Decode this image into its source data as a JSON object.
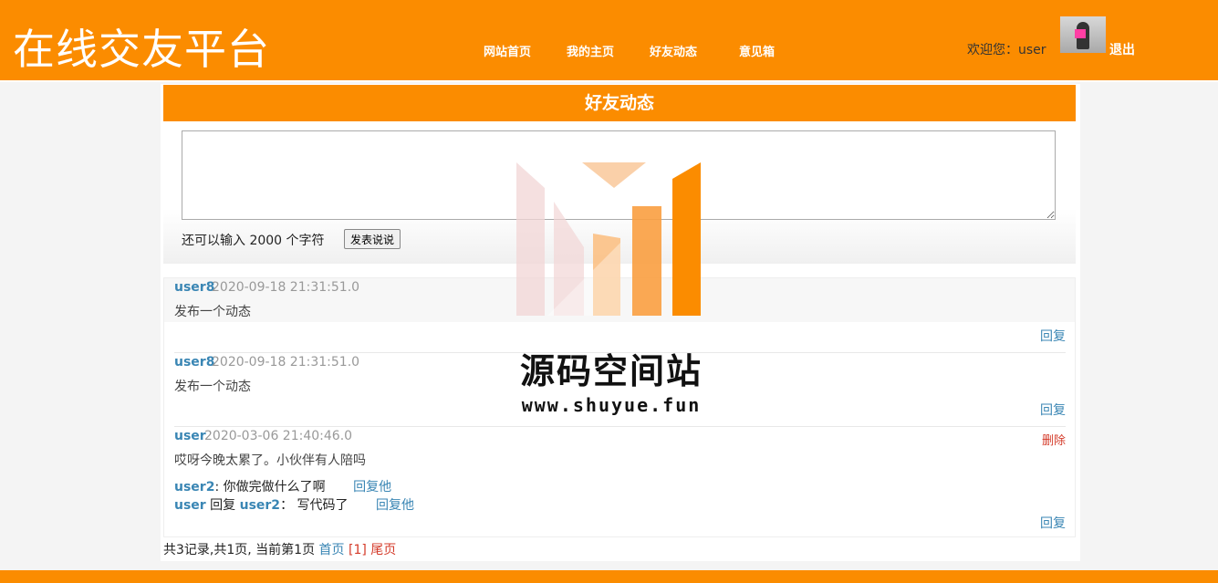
{
  "site": {
    "title": "在线交友平台"
  },
  "nav": {
    "items": [
      {
        "label": "网站首页"
      },
      {
        "label": "我的主页"
      },
      {
        "label": "好友动态"
      },
      {
        "label": "意见箱"
      }
    ]
  },
  "user": {
    "welcome": "欢迎您：user",
    "logout": "退出"
  },
  "page": {
    "title": "好友动态"
  },
  "composer": {
    "char_count": "还可以输入 2000 个字符",
    "publish_label": "发表说说",
    "value": ""
  },
  "feed": [
    {
      "author": "user8",
      "time": "2020-09-18 21:31:51.0",
      "text": "发布一个动态",
      "reply": "回复"
    },
    {
      "author": "user8",
      "time": "2020-09-18 21:31:51.0",
      "text": "发布一个动态",
      "reply": "回复"
    },
    {
      "author": "user",
      "time": "2020-03-06 21:40:46.0",
      "text": "哎呀今晚太累了。小伙伴有人陪吗",
      "delete": "删除",
      "reply": "回复",
      "comments": [
        {
          "user": "user2",
          "sep": ": ",
          "text": "你做完做什么了啊",
          "reply": "回复他"
        },
        {
          "user": "user",
          "mid": " 回复 ",
          "target": "user2",
          "sep": "： ",
          "text": "写代码了",
          "reply": "回复他"
        }
      ]
    }
  ],
  "pager": {
    "summary": "共3记录,共1页, 当前第1页",
    "first": "首页",
    "current": "[1]",
    "last": "尾页"
  },
  "watermark": {
    "title": "源码空间站",
    "url": "www.shuyue.fun"
  },
  "colors": {
    "accent": "#fb8c00",
    "link": "#3a86b4",
    "danger": "#d43b2a"
  }
}
